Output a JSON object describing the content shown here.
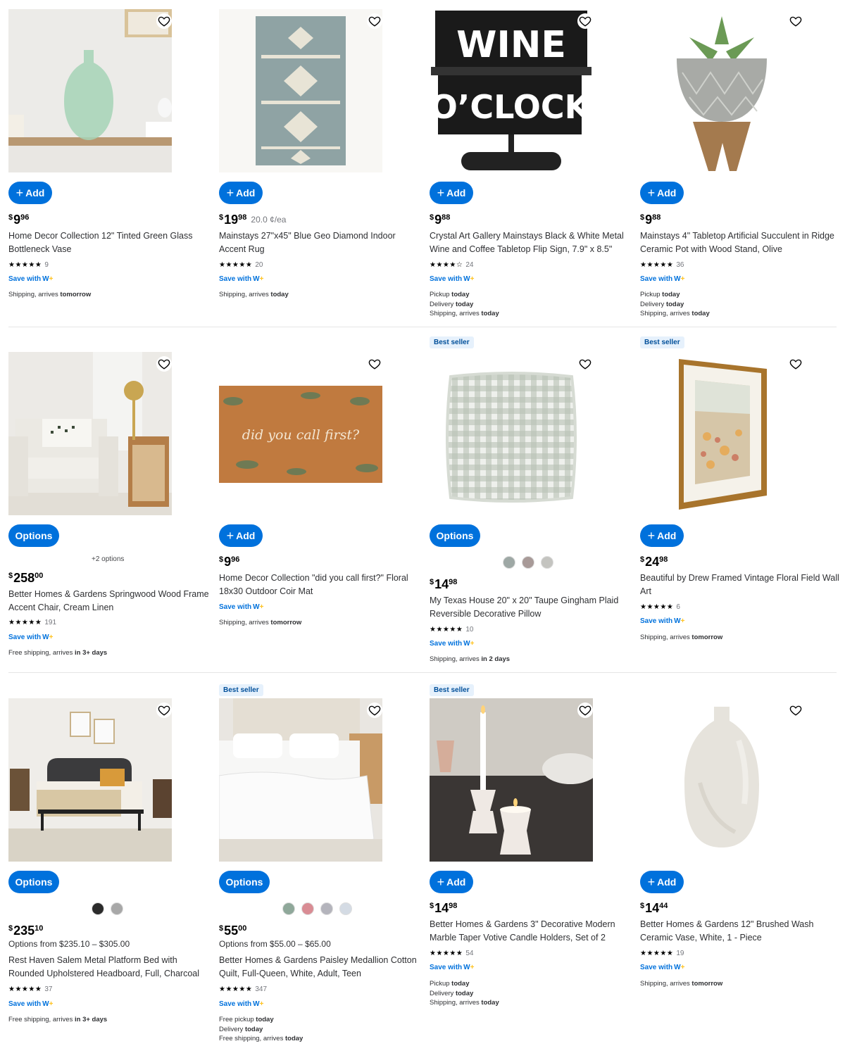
{
  "labels": {
    "add": "Add",
    "options": "Options",
    "best_seller": "Best seller",
    "save_with": "Save with"
  },
  "colors": {
    "accent": "#0071dc",
    "badge_bg": "#e6f1fc",
    "badge_text": "#004f9a",
    "spark": "#ffc220"
  },
  "products": [
    {
      "id": "p1",
      "image_icon": "green-glass-vase-image",
      "action": "Add",
      "price_cur": "$",
      "price_whole": "9",
      "price_cents": "96",
      "unit_price": "",
      "options_range": "",
      "title": "Home Decor Collection 12\" Tinted Green Glass Bottleneck Vase",
      "rating_stars": "★★★★★",
      "rating": 4.5,
      "review_count": "9",
      "save_with": true,
      "fulfillment": [
        [
          "Shipping, arrives ",
          "tomorrow"
        ]
      ],
      "best_seller": false,
      "swatches": [],
      "more_options": ""
    },
    {
      "id": "p2",
      "image_icon": "blue-geo-rug-image",
      "action": "Add",
      "price_cur": "$",
      "price_whole": "19",
      "price_cents": "98",
      "unit_price": "20.0 ¢/ea",
      "options_range": "",
      "title": "Mainstays 27\"x45\" Blue Geo Diamond Indoor Accent Rug",
      "rating_stars": "★★★★★",
      "rating": 5,
      "review_count": "20",
      "save_with": true,
      "fulfillment": [
        [
          "Shipping, arrives ",
          "today"
        ]
      ],
      "best_seller": false,
      "swatches": [],
      "more_options": ""
    },
    {
      "id": "p3",
      "image_icon": "wine-oclock-sign-image",
      "image_text_1": "WINE",
      "image_text_2": "O’CLOCK",
      "action": "Add",
      "price_cur": "$",
      "price_whole": "9",
      "price_cents": "88",
      "unit_price": "",
      "options_range": "",
      "title": "Crystal Art Gallery Mainstays Black & White Metal Wine and Coffee Tabletop Flip Sign, 7.9\" x 8.5\"",
      "rating_stars": "★★★★☆",
      "rating": 4,
      "review_count": "24",
      "save_with": true,
      "fulfillment": [
        [
          "Pickup ",
          "today"
        ],
        [
          "Delivery ",
          "today"
        ],
        [
          "Shipping, arrives ",
          "today"
        ]
      ],
      "best_seller": false,
      "swatches": [],
      "more_options": ""
    },
    {
      "id": "p4",
      "image_icon": "succulent-pot-image",
      "action": "Add",
      "price_cur": "$",
      "price_whole": "9",
      "price_cents": "88",
      "unit_price": "",
      "options_range": "",
      "title": "Mainstays 4\" Tabletop Artificial Succulent in Ridge Ceramic Pot with Wood Stand, Olive",
      "rating_stars": "★★★★★",
      "rating": 4.5,
      "review_count": "36",
      "save_with": true,
      "fulfillment": [
        [
          "Pickup ",
          "today"
        ],
        [
          "Delivery ",
          "today"
        ],
        [
          "Shipping, arrives ",
          "today"
        ]
      ],
      "best_seller": false,
      "swatches": [],
      "more_options": ""
    },
    {
      "id": "p5",
      "image_icon": "accent-chair-image",
      "action": "Options",
      "price_cur": "$",
      "price_whole": "258",
      "price_cents": "00",
      "unit_price": "",
      "options_range": "",
      "title": "Better Homes & Gardens Springwood Wood Frame Accent Chair, Cream Linen",
      "rating_stars": "★★★★★",
      "rating": 5,
      "review_count": "191",
      "save_with": true,
      "fulfillment": [
        [
          "Free shipping, arrives ",
          "in 3+ days"
        ]
      ],
      "best_seller": false,
      "swatches": [],
      "more_options": "+2 options"
    },
    {
      "id": "p6",
      "image_icon": "coir-doormat-image",
      "image_text_1": "did you call first?",
      "action": "Add",
      "price_cur": "$",
      "price_whole": "9",
      "price_cents": "96",
      "unit_price": "",
      "options_range": "",
      "title": "Home Decor Collection \"did you call first?\" Floral 18x30 Outdoor Coir Mat",
      "rating_stars": "",
      "rating": null,
      "review_count": "",
      "save_with": true,
      "fulfillment": [
        [
          "Shipping, arrives ",
          "tomorrow"
        ]
      ],
      "best_seller": false,
      "swatches": [],
      "more_options": ""
    },
    {
      "id": "p7",
      "image_icon": "gingham-pillow-image",
      "action": "Options",
      "price_cur": "$",
      "price_whole": "14",
      "price_cents": "98",
      "unit_price": "",
      "options_range": "",
      "title": "My Texas House 20\" x 20\" Taupe Gingham Plaid Reversible Decorative Pillow",
      "rating_stars": "★★★★★",
      "rating": 4.5,
      "review_count": "10",
      "save_with": true,
      "fulfillment": [
        [
          "Shipping, arrives ",
          "in 2 days"
        ]
      ],
      "best_seller": true,
      "swatches": [
        "#9ea8a5",
        "#a89a98",
        "#c4c4c0"
      ],
      "more_options": ""
    },
    {
      "id": "p8",
      "image_icon": "framed-floral-art-image",
      "action": "Add",
      "price_cur": "$",
      "price_whole": "24",
      "price_cents": "98",
      "unit_price": "",
      "options_range": "",
      "title": "Beautiful by Drew Framed Vintage Floral Field Wall Art",
      "rating_stars": "★★★★★",
      "rating": 5,
      "review_count": "6",
      "save_with": true,
      "fulfillment": [
        [
          "Shipping, arrives ",
          "tomorrow"
        ]
      ],
      "best_seller": true,
      "swatches": [],
      "more_options": ""
    },
    {
      "id": "p9",
      "image_icon": "platform-bed-image",
      "action": "Options",
      "price_cur": "$",
      "price_whole": "235",
      "price_cents": "10",
      "unit_price": "",
      "options_range": "Options from $235.10 – $305.00",
      "title": "Rest Haven Salem Metal Platform Bed with Rounded Upholstered Headboard, Full, Charcoal",
      "rating_stars": "★★★★★",
      "rating": 5,
      "review_count": "37",
      "save_with": true,
      "fulfillment": [
        [
          "Free shipping, arrives ",
          "in 3+ days"
        ]
      ],
      "best_seller": false,
      "swatches": [
        "#2b2b2b",
        "#a8a8a8"
      ],
      "more_options": ""
    },
    {
      "id": "p10",
      "image_icon": "white-quilt-bed-image",
      "action": "Options",
      "price_cur": "$",
      "price_whole": "55",
      "price_cents": "00",
      "unit_price": "",
      "options_range": "Options from $55.00 – $65.00",
      "title": "Better Homes & Gardens Paisley Medallion Cotton Quilt, Full-Queen, White, Adult, Teen",
      "rating_stars": "★★★★★",
      "rating": 5,
      "review_count": "347",
      "save_with": true,
      "fulfillment": [
        [
          "Free pickup ",
          "today"
        ],
        [
          "Delivery ",
          "today"
        ],
        [
          "Free shipping, arrives ",
          "today"
        ]
      ],
      "best_seller": true,
      "swatches": [
        "#8fa89a",
        "#d98c94",
        "#b4b4bc",
        "#d4dbe4"
      ],
      "more_options": ""
    },
    {
      "id": "p11",
      "image_icon": "marble-candle-holders-image",
      "action": "Add",
      "price_cur": "$",
      "price_whole": "14",
      "price_cents": "98",
      "unit_price": "",
      "options_range": "",
      "title": "Better Homes & Gardens 3\" Decorative Modern Marble Taper Votive Candle Holders, Set of 2",
      "rating_stars": "★★★★★",
      "rating": 5,
      "review_count": "54",
      "save_with": true,
      "fulfillment": [
        [
          "Pickup ",
          "today"
        ],
        [
          "Delivery ",
          "today"
        ],
        [
          "Shipping, arrives ",
          "today"
        ]
      ],
      "best_seller": true,
      "swatches": [],
      "more_options": ""
    },
    {
      "id": "p12",
      "image_icon": "white-ceramic-vase-image",
      "action": "Add",
      "price_cur": "$",
      "price_whole": "14",
      "price_cents": "44",
      "unit_price": "",
      "options_range": "",
      "title": "Better Homes & Gardens 12\" Brushed Wash Ceramic Vase, White, 1 - Piece",
      "rating_stars": "★★★★★",
      "rating": 4.5,
      "review_count": "19",
      "save_with": true,
      "fulfillment": [
        [
          "Shipping, arrives ",
          "tomorrow"
        ]
      ],
      "best_seller": false,
      "swatches": [],
      "more_options": ""
    }
  ]
}
